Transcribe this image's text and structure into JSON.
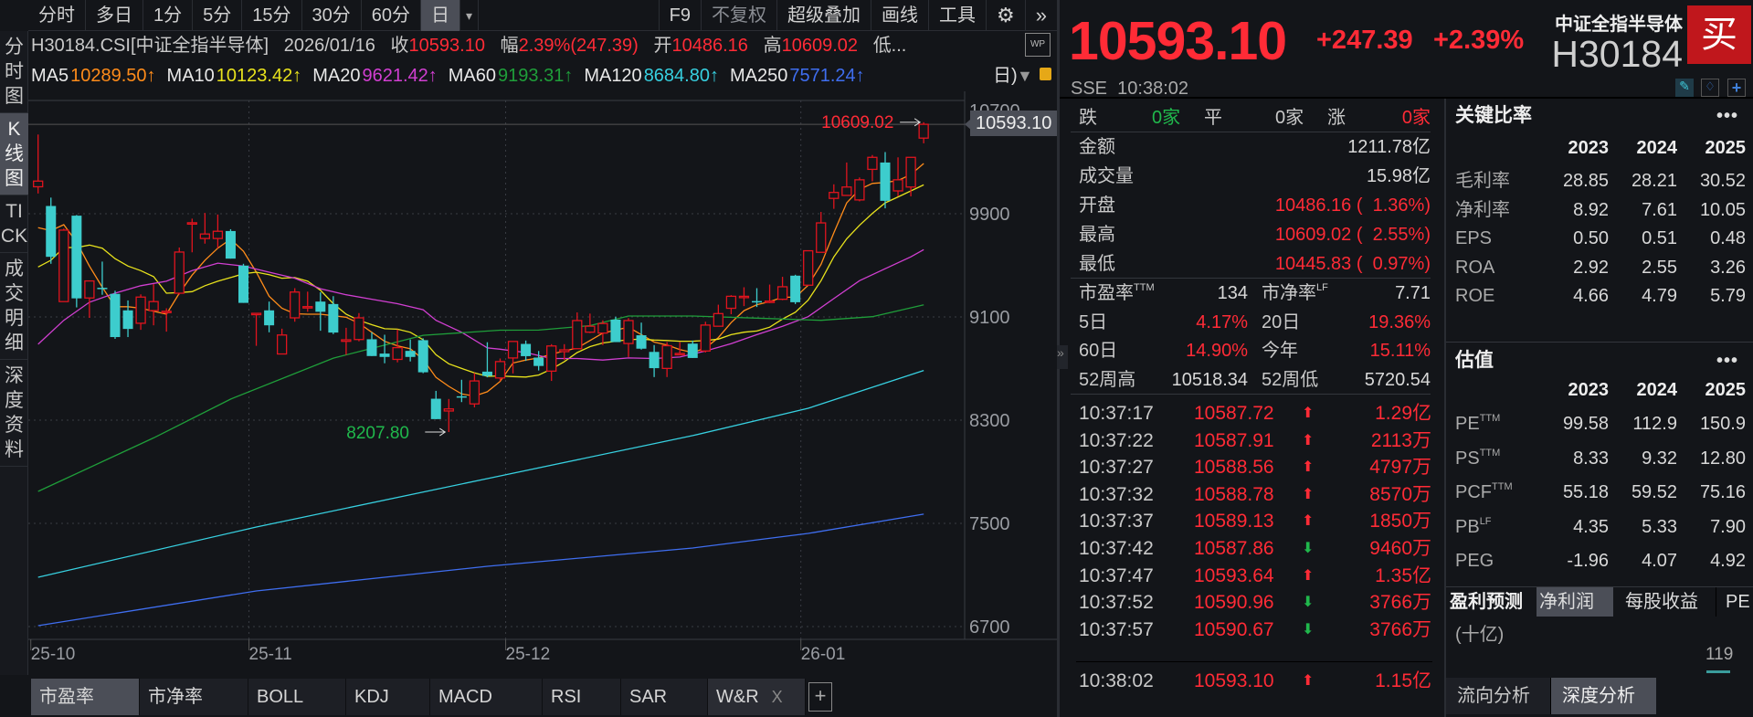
{
  "toolbar": {
    "periods": [
      {
        "label": "分时"
      },
      {
        "label": "多日"
      },
      {
        "label": "1分"
      },
      {
        "label": "5分"
      },
      {
        "label": "15分"
      },
      {
        "label": "30分"
      },
      {
        "label": "60分"
      },
      {
        "label": "日",
        "active": true
      }
    ],
    "dropdown_glyph": "▾",
    "right_items": [
      {
        "label": "F9"
      },
      {
        "label": "不复权",
        "dim": true
      },
      {
        "label": "超级叠加"
      },
      {
        "label": "画线"
      },
      {
        "label": "工具"
      }
    ],
    "gear_glyph": "⚙",
    "more_glyph": "»"
  },
  "left_tabs": [
    {
      "label": "分时图"
    },
    {
      "label": "K线图",
      "active": true
    },
    {
      "label": "TICK"
    },
    {
      "label": "成交明细"
    },
    {
      "label": "深度资料"
    }
  ],
  "info": {
    "code": "H30184.CSI[中证全指半导体]",
    "date": "2026/01/16",
    "close_label": "收",
    "close": "10593.10",
    "change_label": "幅",
    "change": "2.39%(247.39)",
    "open_label": "开",
    "open": "10486.16",
    "high_label": "高",
    "high": "10609.02",
    "low_label": "低...",
    "wp_label": "WP"
  },
  "ma_row": {
    "items": [
      {
        "name": "MA5",
        "value": "10289.50↑",
        "color": "#ff8c1a"
      },
      {
        "name": "MA10",
        "value": "10123.42↑",
        "color": "#e8e21c"
      },
      {
        "name": "MA20",
        "value": "9621.42↑",
        "color": "#d13fd1"
      },
      {
        "name": "MA60",
        "value": "9193.31↑",
        "color": "#1f9e3a"
      },
      {
        "name": "MA120",
        "value": "8684.80↑",
        "color": "#37d0e0"
      },
      {
        "name": "MA250",
        "value": "7571.24↑",
        "color": "#3f6ef0"
      }
    ],
    "period_toggle": "日)",
    "triangle": "▼"
  },
  "chart_data": {
    "type": "candlestick",
    "title": "H30184.CSI 日K",
    "ylim": [
      6700,
      10700
    ],
    "yticks": [
      "10700",
      "9900",
      "9100",
      "8300",
      "7500",
      "6700"
    ],
    "xticks": [
      {
        "label": "25-10",
        "index": 1
      },
      {
        "label": "25-11",
        "index": 18
      },
      {
        "label": "25-12",
        "index": 38
      },
      {
        "label": "26-01",
        "index": 61
      }
    ],
    "up_color": "#e0141e",
    "down_color": "#3dcdcd",
    "candles_ohlc": [
      [
        10109,
        10514,
        10057,
        10153
      ],
      [
        9960,
        10025,
        9512,
        9566
      ],
      [
        9219,
        9785,
        9219,
        9773
      ],
      [
        9885,
        9890,
        9174,
        9244
      ],
      [
        9247,
        9379,
        9093,
        9379
      ],
      [
        9326,
        9529,
        9272,
        9320
      ],
      [
        9279,
        9303,
        8930,
        8944
      ],
      [
        9151,
        9228,
        8944,
        9007
      ],
      [
        9051,
        9275,
        9000,
        9254
      ],
      [
        9149,
        9354,
        9035,
        9219
      ],
      [
        9137,
        9167,
        8986,
        9144
      ],
      [
        9284,
        9638,
        9272,
        9603
      ],
      [
        9827,
        9862,
        9601,
        9830
      ],
      [
        9708,
        9906,
        9668,
        9743
      ],
      [
        9708,
        9894,
        9633,
        9764
      ],
      [
        9766,
        9780,
        9552,
        9552
      ],
      [
        9498,
        9512,
        9209,
        9209
      ],
      [
        9121,
        9128,
        8876,
        9128
      ],
      [
        9151,
        9219,
        8981,
        9035
      ],
      [
        8813,
        9009,
        8813,
        8960
      ],
      [
        9093,
        9323,
        9063,
        9293
      ],
      [
        9177,
        9296,
        9140,
        9180
      ],
      [
        9219,
        9291,
        8993,
        9140
      ],
      [
        9200,
        9261,
        8967,
        8979
      ],
      [
        8911,
        9016,
        8806,
        8923
      ],
      [
        8925,
        9130,
        8911,
        9093
      ],
      [
        8927,
        8981,
        8797,
        8797
      ],
      [
        8816,
        8962,
        8741,
        8790
      ],
      [
        8771,
        9003,
        8748,
        8862
      ],
      [
        8837,
        8925,
        8755,
        8790
      ],
      [
        8920,
        8934,
        8664,
        8671
      ],
      [
        8466,
        8527,
        8308,
        8308
      ],
      [
        8371,
        8464,
        8207.8,
        8387
      ],
      [
        8485,
        8613,
        8440,
        8475
      ],
      [
        8426,
        8666,
        8399,
        8604
      ],
      [
        8676,
        8904,
        8632,
        8643
      ],
      [
        8627,
        8778,
        8604,
        8754
      ],
      [
        8782,
        8910,
        8662,
        8910
      ],
      [
        8891,
        8917,
        8759,
        8796
      ],
      [
        8785,
        8836,
        8685,
        8720
      ],
      [
        8680,
        8889,
        8604,
        8875
      ],
      [
        8831,
        8889,
        8766,
        8845
      ],
      [
        8854,
        9135,
        8854,
        9072
      ],
      [
        8982,
        9126,
        8975,
        9028
      ],
      [
        8975,
        9074,
        8882,
        9049
      ],
      [
        9079,
        9102,
        8905,
        8905
      ],
      [
        8894,
        9091,
        8789,
        9072
      ],
      [
        8958,
        9056,
        8847,
        8854
      ],
      [
        8829,
        8882,
        8634,
        8703
      ],
      [
        8701,
        8905,
        8634,
        8877
      ],
      [
        8810,
        8905,
        8810,
        8817
      ],
      [
        8893,
        8917,
        8782,
        8782
      ],
      [
        8836,
        9063,
        8824,
        9037
      ],
      [
        9028,
        9195,
        9028,
        9126
      ],
      [
        9167,
        9269,
        9121,
        9260
      ],
      [
        9253,
        9330,
        9184,
        9260
      ],
      [
        9223,
        9323,
        9177,
        9214
      ],
      [
        9214,
        9351,
        9207,
        9223
      ],
      [
        9237,
        9411,
        9230,
        9334
      ],
      [
        9420,
        9427,
        9200,
        9214
      ],
      [
        9346,
        9613,
        9346,
        9613
      ],
      [
        9601,
        9914,
        9601,
        9829
      ],
      [
        10019,
        10128,
        9938,
        10065
      ],
      [
        10042,
        10297,
        10042,
        10107
      ],
      [
        10007,
        10181,
        9996,
        10163
      ],
      [
        10244,
        10355,
        10151,
        10337
      ],
      [
        10297,
        10378,
        9942,
        10000
      ],
      [
        10077,
        10337,
        10035,
        10163
      ],
      [
        10107,
        10337,
        10035,
        10337
      ],
      [
        10486.16,
        10609.02,
        10445.83,
        10593.1
      ]
    ],
    "ma_lines": [
      {
        "name": "MA5",
        "color": "#ff8c1a",
        "values": [
          9792,
          9769,
          9815,
          9680,
          9494,
          9330,
          9179,
          9179,
          9167,
          9144,
          9121,
          9284,
          9424,
          9540,
          9633,
          9703,
          9610,
          9447,
          9261,
          9167,
          9125,
          9121,
          9121,
          9109,
          9098,
          9051,
          8981,
          8911,
          8876,
          8853,
          8771,
          8631,
          8562,
          8503,
          8487,
          8520,
          8600,
          8743,
          8766,
          8782,
          8812,
          8836,
          8859,
          8917,
          8975,
          8998,
          9021,
          8963,
          8905,
          8882,
          8847,
          8824,
          8859,
          8940,
          9056,
          9149,
          9195,
          9218,
          9253,
          9253,
          9346,
          9508,
          9752,
          9984,
          10088,
          10135,
          10142,
          10158,
          10204,
          10289.5
        ]
      },
      {
        "name": "MA10",
        "color": "#e8e21c",
        "values": [
          9487,
          9540,
          9638,
          9638,
          9657,
          9633,
          9552,
          9494,
          9459,
          9412,
          9284,
          9289,
          9296,
          9342,
          9377,
          9405,
          9435,
          9447,
          9428,
          9400,
          9405,
          9377,
          9307,
          9203,
          9121,
          9074,
          9040,
          9009,
          9005,
          8981,
          8923,
          8807,
          8737,
          8701,
          8667,
          8640,
          8643,
          8638,
          8634,
          8650,
          8696,
          8754,
          8824,
          8870,
          8898,
          8912,
          8924,
          8928,
          8921,
          8917,
          8912,
          8912,
          8917,
          8928,
          8963,
          8982,
          8991,
          9021,
          9084,
          9137,
          9230,
          9381,
          9566,
          9706,
          9810,
          9903,
          9984,
          10030,
          10077,
          10123.42
        ]
      },
      {
        "name": "MA20",
        "color": "#d13fd1",
        "points": [
          [
            1,
            8888
          ],
          [
            3,
            9074
          ],
          [
            5,
            9214
          ],
          [
            7,
            9284
          ],
          [
            9,
            9342
          ],
          [
            11,
            9377
          ],
          [
            13,
            9459
          ],
          [
            15,
            9517
          ],
          [
            17,
            9494
          ],
          [
            19,
            9447
          ],
          [
            21,
            9400
          ],
          [
            23,
            9319
          ],
          [
            25,
            9272
          ],
          [
            27,
            9237
          ],
          [
            29,
            9203
          ],
          [
            31,
            9156
          ],
          [
            32,
            9074
          ],
          [
            34,
            8981
          ],
          [
            36,
            8860
          ],
          [
            37,
            8850
          ],
          [
            39,
            8824
          ],
          [
            41,
            8778
          ],
          [
            43,
            8778
          ],
          [
            45,
            8766
          ],
          [
            47,
            8782
          ],
          [
            49,
            8778
          ],
          [
            51,
            8789
          ],
          [
            53,
            8836
          ],
          [
            55,
            8893
          ],
          [
            57,
            8963
          ],
          [
            59,
            9028
          ],
          [
            61,
            9102
          ],
          [
            63,
            9242
          ],
          [
            65,
            9381
          ],
          [
            67,
            9474
          ],
          [
            69,
            9566
          ],
          [
            70,
            9621.42
          ]
        ]
      },
      {
        "name": "MA60",
        "color": "#1f9e3a",
        "points": [
          [
            1,
            7748
          ],
          [
            10,
            8163
          ],
          [
            16,
            8463
          ],
          [
            24,
            8781
          ],
          [
            31,
            8958
          ],
          [
            37,
            8997
          ],
          [
            40,
            8998
          ],
          [
            44,
            9033
          ],
          [
            47,
            9107
          ],
          [
            52,
            9107
          ],
          [
            57,
            9091
          ],
          [
            62,
            9074
          ],
          [
            66,
            9102
          ],
          [
            70,
            9193.31
          ]
        ]
      },
      {
        "name": "MA120",
        "color": "#37d0e0",
        "points": [
          [
            1,
            7082
          ],
          [
            18,
            7472
          ],
          [
            36,
            7847
          ],
          [
            52,
            8180
          ],
          [
            61,
            8392
          ],
          [
            70,
            8684.8
          ]
        ]
      },
      {
        "name": "MA250",
        "color": "#3f6ef0",
        "points": [
          [
            1,
            6707
          ],
          [
            18,
            6976
          ],
          [
            36,
            7167
          ],
          [
            52,
            7309
          ],
          [
            61,
            7422
          ],
          [
            70,
            7571.24
          ]
        ]
      }
    ],
    "annotations": {
      "high_label": "10609.02",
      "low_label": "8207.80",
      "last_price": "10593.10"
    }
  },
  "indicator_tabs": [
    {
      "label": "市盈率",
      "active": true
    },
    {
      "label": "市净率"
    },
    {
      "label": "BOLL"
    },
    {
      "label": "KDJ"
    },
    {
      "label": "MACD"
    },
    {
      "label": "RSI"
    },
    {
      "label": "SAR"
    },
    {
      "label": "W&R",
      "closable": true
    }
  ],
  "indicator_close": "X",
  "indicator_add": "+",
  "quote": {
    "price": "10593.10",
    "change": "+247.39",
    "change_pct": "+2.39%",
    "name": "中证全指半导体",
    "code": "H30184",
    "buy_label": "买",
    "exchange": "SSE",
    "time": "10:38:02"
  },
  "breadth": {
    "down_label": "跌",
    "down": "0家",
    "flat_label": "平",
    "flat": "0家",
    "up_label": "涨",
    "up": "0家"
  },
  "stats": [
    {
      "label": "金额",
      "value": "1211.78亿",
      "color": "#d8d8d8"
    },
    {
      "label": "成交量",
      "value": "15.98亿",
      "color": "#d8d8d8"
    },
    {
      "label": "开盘",
      "value": "10486.16 (  1.36%)",
      "color": "#ff2b36"
    },
    {
      "label": "最高",
      "value": "10609.02 (  2.55%)",
      "color": "#ff2b36"
    },
    {
      "label": "最低",
      "value": "10445.83 (  0.97%)",
      "color": "#ff2b36"
    }
  ],
  "stats2": [
    {
      "l1": "市盈率",
      "s1": "TTM",
      "v1": "134",
      "c1": "#d8d8d8",
      "l2": "市净率",
      "s2": "LF",
      "v2": "7.71",
      "c2": "#d8d8d8"
    },
    {
      "l1": "5日",
      "s1": "",
      "v1": "4.17%",
      "c1": "#ff2b36",
      "l2": "20日",
      "s2": "",
      "v2": "19.36%",
      "c2": "#ff2b36"
    },
    {
      "l1": "60日",
      "s1": "",
      "v1": "14.90%",
      "c1": "#ff2b36",
      "l2": "今年",
      "s2": "",
      "v2": "15.11%",
      "c2": "#ff2b36"
    },
    {
      "l1": "52周高",
      "s1": "",
      "v1": "10518.34",
      "c1": "#d8d8d8",
      "l2": "52周低",
      "s2": "",
      "v2": "5720.54",
      "c2": "#d8d8d8"
    }
  ],
  "ticks": [
    {
      "time": "10:37:17",
      "price": "10587.72",
      "dir": "up",
      "amount": "1.29亿"
    },
    {
      "time": "10:37:22",
      "price": "10587.91",
      "dir": "up",
      "amount": "2113万"
    },
    {
      "time": "10:37:27",
      "price": "10588.56",
      "dir": "up",
      "amount": "4797万"
    },
    {
      "time": "10:37:32",
      "price": "10588.78",
      "dir": "up",
      "amount": "8570万"
    },
    {
      "time": "10:37:37",
      "price": "10589.13",
      "dir": "up",
      "amount": "1850万"
    },
    {
      "time": "10:37:42",
      "price": "10587.86",
      "dir": "down",
      "amount": "9460万"
    },
    {
      "time": "10:37:47",
      "price": "10593.64",
      "dir": "up",
      "amount": "1.35亿"
    },
    {
      "time": "10:37:52",
      "price": "10590.96",
      "dir": "down",
      "amount": "3766万"
    },
    {
      "time": "10:37:57",
      "price": "10590.67",
      "dir": "down",
      "amount": "3766万"
    },
    {
      "time": "10:38:02",
      "price": "10593.10",
      "dir": "up",
      "amount": "1.15亿"
    }
  ],
  "key_ratios": {
    "title": "关键比率",
    "more": "•••",
    "years": [
      "2023",
      "2024",
      "2025"
    ],
    "rows": [
      {
        "label": "毛利率",
        "sup": "",
        "values": [
          "28.85",
          "28.21",
          "30.52"
        ]
      },
      {
        "label": "净利率",
        "sup": "",
        "values": [
          "8.92",
          "7.61",
          "10.05"
        ]
      },
      {
        "label": "EPS",
        "sup": "",
        "values": [
          "0.50",
          "0.51",
          "0.48"
        ]
      },
      {
        "label": "ROA",
        "sup": "",
        "values": [
          "2.92",
          "2.55",
          "3.26"
        ]
      },
      {
        "label": "ROE",
        "sup": "",
        "values": [
          "4.66",
          "4.79",
          "5.79"
        ]
      }
    ]
  },
  "valuation": {
    "title": "估值",
    "more": "•••",
    "years": [
      "2023",
      "2024",
      "2025"
    ],
    "rows": [
      {
        "label": "PE",
        "sup": "TTM",
        "values": [
          "99.58",
          "112.9",
          "150.9"
        ]
      },
      {
        "label": "PS",
        "sup": "TTM",
        "values": [
          "8.33",
          "9.32",
          "12.80"
        ]
      },
      {
        "label": "PCF",
        "sup": "TTM",
        "values": [
          "55.18",
          "59.52",
          "75.16"
        ]
      },
      {
        "label": "PB",
        "sup": "LF",
        "values": [
          "4.35",
          "5.33",
          "7.90"
        ]
      },
      {
        "label": "PEG",
        "sup": "",
        "values": [
          "-1.96",
          "4.07",
          "4.92"
        ]
      }
    ]
  },
  "forecast": {
    "title": "盈利预测",
    "tabs": [
      {
        "label": "净利润",
        "active": true
      },
      {
        "label": "每股收益"
      },
      {
        "label": "PE"
      }
    ],
    "unit": "(十亿)",
    "bar_value": "119"
  },
  "bottom_right_tabs": [
    {
      "label": "流向分析"
    },
    {
      "label": "深度分析",
      "active": true
    }
  ]
}
